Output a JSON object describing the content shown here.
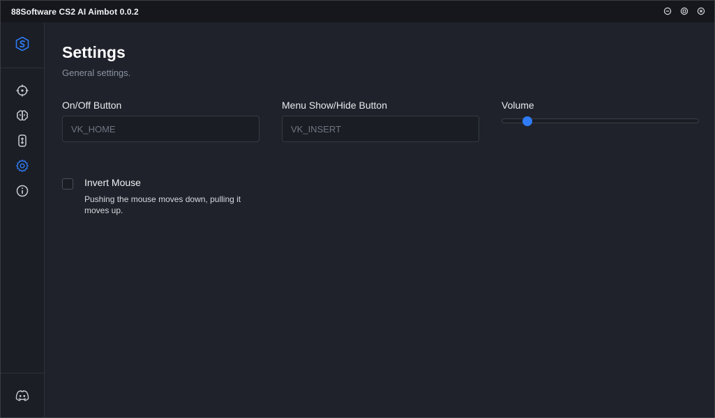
{
  "window": {
    "title": "88Software CS2 AI Aimbot 0.0.2",
    "controls": [
      "minimize-icon",
      "maximize-icon",
      "close-icon"
    ]
  },
  "sidebar": {
    "brand_icon": "brand-logo-icon",
    "items": [
      {
        "icon": "crosshair-icon",
        "active": false
      },
      {
        "icon": "brain-icon",
        "active": false
      },
      {
        "icon": "mouse-icon",
        "active": false
      },
      {
        "icon": "gear-icon",
        "active": true
      },
      {
        "icon": "info-icon",
        "active": false
      }
    ],
    "footer_icon": "discord-icon"
  },
  "page": {
    "title": "Settings",
    "subtitle": "General settings."
  },
  "fields": {
    "onoff": {
      "label": "On/Off Button",
      "value": "VK_HOME"
    },
    "menu": {
      "label": "Menu Show/Hide Button",
      "value": "VK_INSERT"
    },
    "volume": {
      "label": "Volume",
      "value": 0.13
    }
  },
  "invert_mouse": {
    "label": "Invert Mouse",
    "description": "Pushing the mouse moves down, pulling it moves up.",
    "checked": false
  },
  "colors": {
    "accent": "#2f7cf6",
    "background": "#1f222a",
    "titlebar": "#15171c"
  }
}
